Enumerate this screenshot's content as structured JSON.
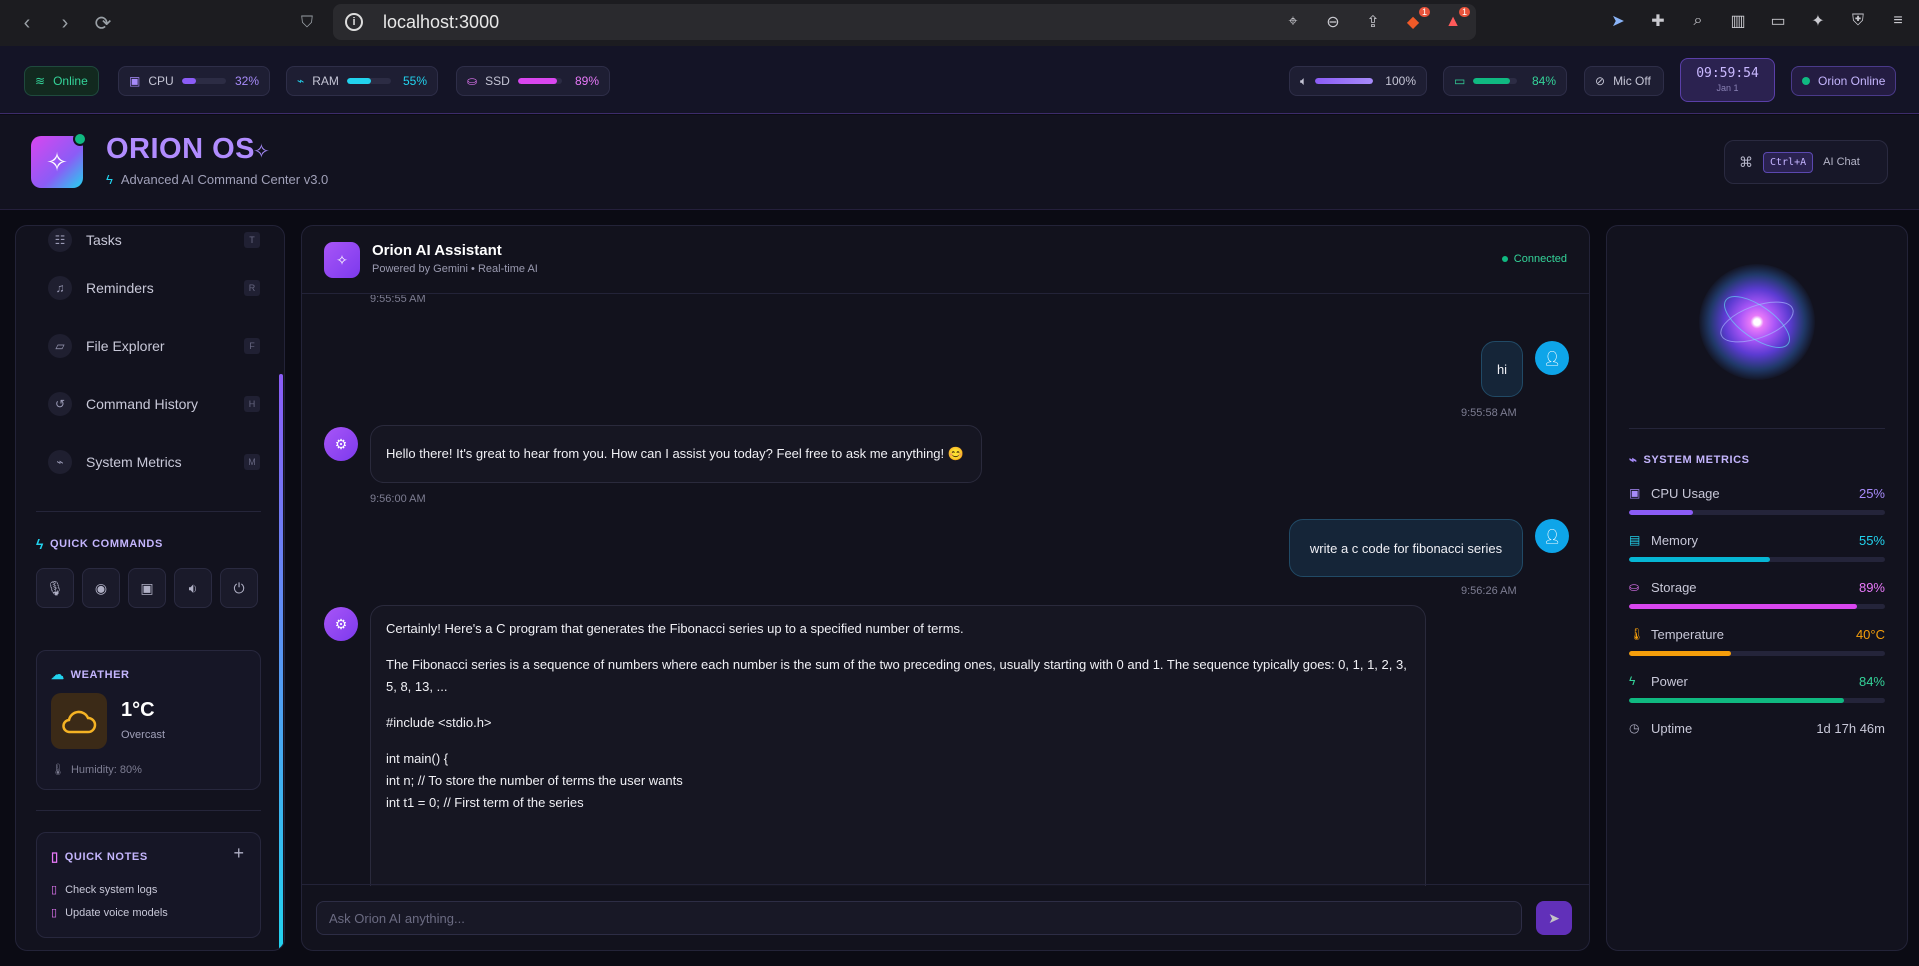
{
  "browser": {
    "url": "localhost:3000",
    "brave_badge": "1",
    "alert_badge": "1"
  },
  "statusbar": {
    "online": "Online",
    "cpu_label": "CPU",
    "cpu_value": "32%",
    "cpu_pct": 32,
    "ram_label": "RAM",
    "ram_value": "55%",
    "ram_pct": 55,
    "ssd_label": "SSD",
    "ssd_value": "89%",
    "ssd_pct": 89,
    "volume_value": "100%",
    "volume_pct": 100,
    "battery_value": "84%",
    "battery_pct": 84,
    "mic": "Mic Off",
    "clock_time": "09:59:54",
    "clock_date": "Jan 1",
    "orion_status": "Orion Online"
  },
  "header": {
    "brand": "ORION OS",
    "subtitle": "Advanced AI Command Center v3.0",
    "shortcut_key": "Ctrl+A",
    "shortcut_label": "AI Chat"
  },
  "sidebar": {
    "items": [
      {
        "label": "Tasks",
        "key": "T"
      },
      {
        "label": "Reminders",
        "key": "R"
      },
      {
        "label": "File Explorer",
        "key": "F"
      },
      {
        "label": "Command History",
        "key": "H"
      },
      {
        "label": "System Metrics",
        "key": "M"
      }
    ],
    "quick_commands_title": "QUICK COMMANDS",
    "weather_title": "WEATHER",
    "weather_temp": "1°C",
    "weather_desc": "Overcast",
    "weather_humidity": "Humidity: 80%",
    "notes_title": "QUICK NOTES",
    "notes": [
      "Check system logs",
      "Update voice models"
    ]
  },
  "chat": {
    "title": "Orion AI Assistant",
    "subtitle": "Powered by Gemini • Real-time AI",
    "status": "Connected",
    "top_ts": "9:55:55 AM",
    "messages": [
      {
        "role": "user",
        "text": "hi",
        "time": "9:55:58 AM"
      },
      {
        "role": "ai",
        "text": "Hello there! It's great to hear from you. How can I assist you today? Feel free to ask me anything! 😊",
        "time": "9:56:00 AM"
      },
      {
        "role": "user",
        "text": "write a c code for fibonacci series",
        "time": "9:56:26 AM"
      }
    ],
    "long_reply": {
      "p1": "Certainly! Here's a C program that generates the Fibonacci series up to a specified number of terms.",
      "p2": "The Fibonacci series is a sequence of numbers where each number is the sum of the two preceding ones, usually starting with 0 and 1. The sequence typically goes: 0, 1, 1, 2, 3, 5, 8, 13, ...",
      "l1": "#include <stdio.h>",
      "l2": "int main() {",
      "l3": "int n; // To store the number of terms the user wants",
      "l4": "int t1 = 0; // First term of the series"
    },
    "input_placeholder": "Ask Orion AI anything..."
  },
  "metrics": {
    "title": "SYSTEM METRICS",
    "cpu_label": "CPU Usage",
    "cpu_value": "25%",
    "cpu_pct": 25,
    "mem_label": "Memory",
    "mem_value": "55%",
    "mem_pct": 55,
    "storage_label": "Storage",
    "storage_value": "89%",
    "storage_pct": 89,
    "temp_label": "Temperature",
    "temp_value": "40°C",
    "temp_pct": 40,
    "power_label": "Power",
    "power_value": "84%",
    "power_pct": 84,
    "uptime_label": "Uptime",
    "uptime_value": "1d 17h 46m"
  },
  "colors": {
    "accent": "#8b5cf6",
    "cyan": "#22d3ee",
    "magenta": "#d946ef",
    "green": "#10b981",
    "orange": "#f59e0b"
  }
}
